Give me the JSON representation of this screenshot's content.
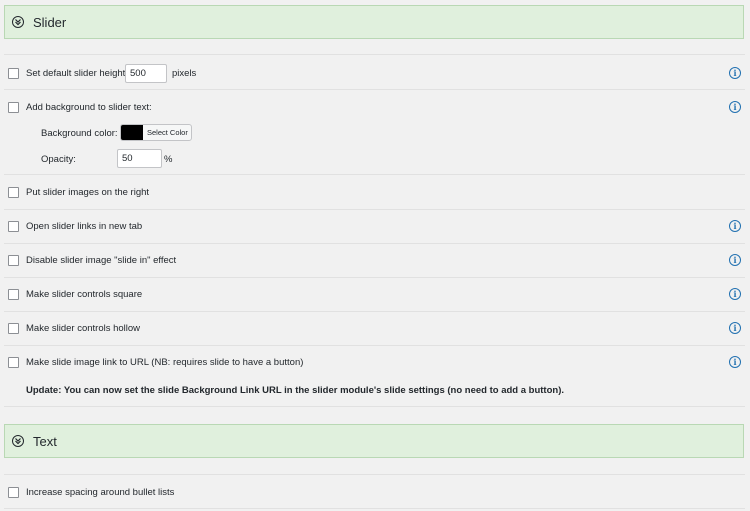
{
  "sections": {
    "slider": {
      "title": "Slider"
    },
    "text": {
      "title": "Text"
    }
  },
  "slider_options": {
    "height": {
      "label": "Set default slider height:",
      "value": "500",
      "unit": "pixels"
    },
    "background": {
      "label": "Add background to slider text:",
      "color_label": "Background color:",
      "color_value": "#000000",
      "color_button": "Select Color",
      "opacity_label": "Opacity:",
      "opacity_value": "50",
      "opacity_unit": "%"
    },
    "images_right": "Put slider images on the right",
    "new_tab": "Open slider links in new tab",
    "disable_slide_in": "Disable slider image \"slide in\" effect",
    "controls_square": "Make slider controls square",
    "controls_hollow": "Make slider controls hollow",
    "image_link": "Make slide image link to URL (NB: requires slide to have a button)",
    "update_note": "Update: You can now set the slide Background Link URL in the slider module's slide settings (no need to add a button)."
  },
  "text_options": {
    "bullet_spacing": "Increase spacing around bullet lists"
  },
  "icons": {
    "section_toggle": "chevron-down-circle-icon",
    "info": "info-icon"
  }
}
